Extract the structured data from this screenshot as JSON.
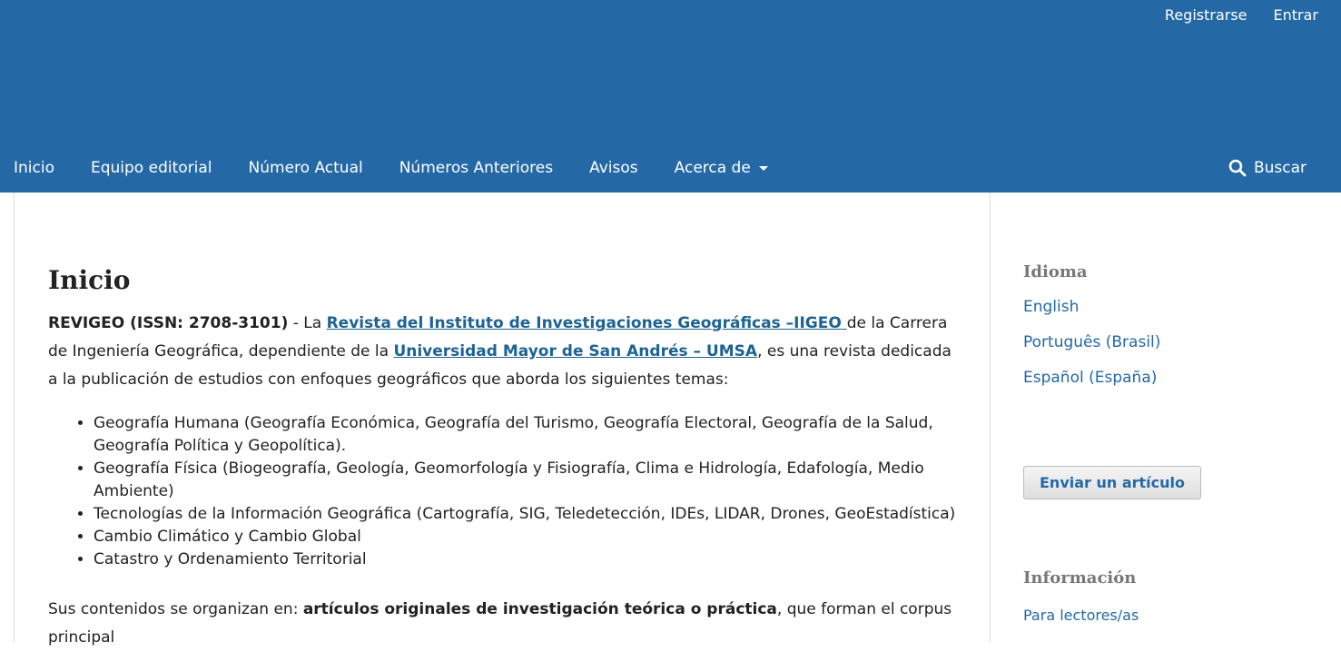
{
  "header": {
    "user_nav": {
      "register": "Registrarse",
      "login": "Entrar"
    },
    "nav": [
      {
        "label": "Inicio"
      },
      {
        "label": "Equipo editorial"
      },
      {
        "label": "Número Actual"
      },
      {
        "label": "Números Anteriores"
      },
      {
        "label": "Avisos"
      },
      {
        "label": "Acerca de"
      }
    ],
    "search_label": "Buscar"
  },
  "main": {
    "title": "Inicio",
    "intro": {
      "bold_issn": "REVIGEO (ISSN: 2708-3101)",
      "t1": " - La ",
      "link1": "Revista del Instituto de Investigaciones Geográficas –IIGEO ",
      "t2": "de la Carrera de Ingeniería Geográfica, dependiente de la ",
      "link2": "Universidad  Mayor de San Andrés – UMSA",
      "t3": ", es una revista dedicada a la publicación de estudios con enfoques geográficos que aborda los siguientes temas:"
    },
    "topics": [
      "Geografía Humana (Geografía Económica, Geografía del Turismo, Geografía Electoral, Geografía de la Salud, Geografía Política y Geopolítica).",
      "Geografía Física (Biogeografía, Geología, Geomorfología y Fisiografía, Clima e Hidrología, Edafología, Medio Ambiente)",
      "Tecnologías de la Información Geográfica (Cartografía, SIG, Teledetección, IDEs, LIDAR, Drones, GeoEstadística)",
      "Cambio Climático y Cambio Global",
      "Catastro y Ordenamiento Territorial"
    ],
    "para2": {
      "t1": "Sus contenidos se organizan en: ",
      "bold": "artículos originales de investigación teórica o práctica",
      "t2": ", que forman el corpus principal"
    }
  },
  "sidebar": {
    "language": {
      "title": "Idioma",
      "options": [
        "English",
        "Português (Brasil)",
        "Español (España)"
      ]
    },
    "submit_label": "Enviar un artículo",
    "info": {
      "title": "Información",
      "readers_link": "Para lectores/as"
    }
  },
  "colors": {
    "header_bg": "#2469a6",
    "link": "#2469a6"
  }
}
